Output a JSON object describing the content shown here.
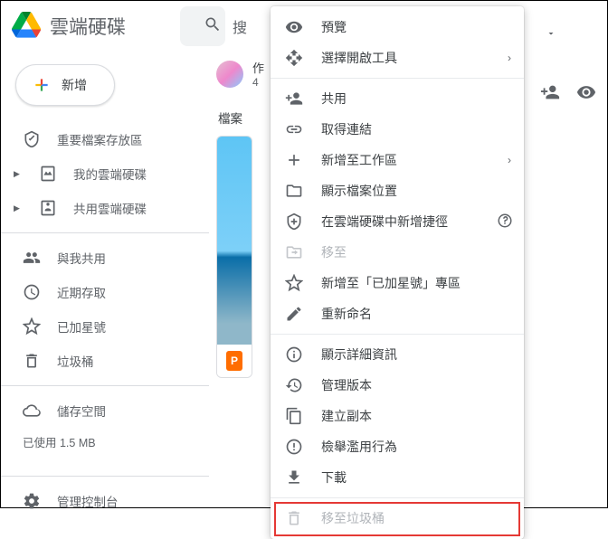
{
  "header": {
    "app_title": "雲端硬碟",
    "search_partial": "搜"
  },
  "sidebar": {
    "new_label": "新增",
    "items": [
      {
        "label": "重要檔案存放區",
        "icon": "priority"
      },
      {
        "label": "我的雲端硬碟",
        "icon": "my-drive",
        "expandable": true
      },
      {
        "label": "共用雲端硬碟",
        "icon": "shared-drive",
        "expandable": true
      },
      {
        "label": "與我共用",
        "icon": "shared-with-me"
      },
      {
        "label": "近期存取",
        "icon": "recent"
      },
      {
        "label": "已加星號",
        "icon": "starred"
      },
      {
        "label": "垃圾桶",
        "icon": "trash"
      },
      {
        "label": "儲存空間",
        "icon": "storage"
      }
    ],
    "storage_used": "已使用 1.5 MB",
    "admin_console": "管理控制台"
  },
  "main": {
    "author_name": "作",
    "author_meta": "4",
    "section_label": "檔案",
    "file": {
      "badge": "P"
    }
  },
  "context_menu": {
    "items": [
      {
        "label": "預覽",
        "icon": "eye"
      },
      {
        "label": "選擇開啟工具",
        "icon": "open-with",
        "submenu": true
      },
      {
        "divider": true
      },
      {
        "label": "共用",
        "icon": "person-add"
      },
      {
        "label": "取得連結",
        "icon": "link"
      },
      {
        "label": "新增至工作區",
        "icon": "plus",
        "submenu": true
      },
      {
        "label": "顯示檔案位置",
        "icon": "folder"
      },
      {
        "label": "在雲端硬碟中新增捷徑",
        "icon": "add-shortcut",
        "help": true
      },
      {
        "label": "移至",
        "icon": "move-to",
        "disabled": true
      },
      {
        "label": "新增至「已加星號」專區",
        "icon": "star"
      },
      {
        "label": "重新命名",
        "icon": "rename"
      },
      {
        "divider": true
      },
      {
        "label": "顯示詳細資訊",
        "icon": "info"
      },
      {
        "label": "管理版本",
        "icon": "versions"
      },
      {
        "label": "建立副本",
        "icon": "copy"
      },
      {
        "label": "檢舉濫用行為",
        "icon": "report"
      },
      {
        "label": "下載",
        "icon": "download"
      },
      {
        "divider": true
      },
      {
        "label": "移至垃圾桶",
        "icon": "trash",
        "disabled": true,
        "highlight": true
      }
    ]
  }
}
